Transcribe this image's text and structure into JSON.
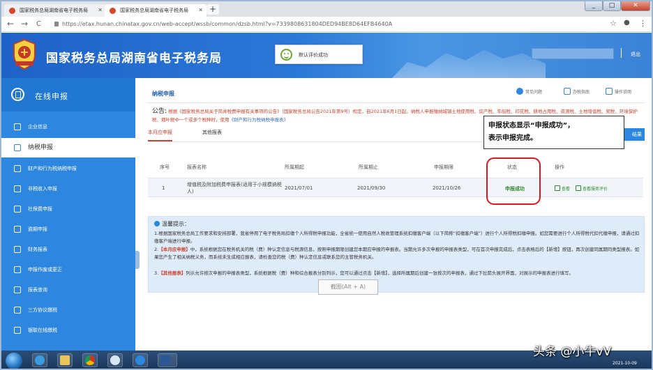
{
  "browser": {
    "tabs": [
      {
        "title": "国家税务总局湖南省电子税务局"
      },
      {
        "title": "国家税务总局湖南省电子税务局"
      }
    ],
    "new_tab": "+",
    "url": "https://etax.hunan.chinatax.gov.cn/web-accept/wssb/common/dzsb.html?v=7339808631804DED94BE8D64EFB4640A",
    "nav": {
      "back": "←",
      "forward": "→",
      "reload": "C"
    },
    "star": "☆",
    "menu": "⋮",
    "win": {
      "min": "_",
      "max": "□",
      "close": "✕"
    }
  },
  "header": {
    "site_title": "国家税务总局湖南省电子税务局",
    "toast_text": "默认评价成功",
    "logout": "退出",
    "emblem_text": "国家税务"
  },
  "sidebar": {
    "title": "在线申报",
    "items": [
      {
        "label": "企业信息"
      },
      {
        "label": "纳税申报"
      },
      {
        "label": "财产和行为税纳税申报"
      },
      {
        "label": "非税收入申报"
      },
      {
        "label": "社保费申报"
      },
      {
        "label": "逾期申报"
      },
      {
        "label": "财务报表"
      },
      {
        "label": "申报作废或更正"
      },
      {
        "label": "报表查询"
      },
      {
        "label": "三方协议缴税"
      },
      {
        "label": "银联在线缴税"
      }
    ]
  },
  "main": {
    "breadcrumb": "纳税申报",
    "tools": [
      "常见问题",
      "办税指南",
      "操作说明"
    ],
    "notice_label": "公告:",
    "notice_text": "根据《国家税务总局关于简并税费申报有关事项的公告》（国家税务总局公告2021年第9号）规定，自2021年6月1日起，纳税人申报缴纳城镇土地使用税、房产税、车船税、印花税、耕地占用税、资源税、土地增值税、契税、环境保护税、烟叶税中一个或多个税种时，使用",
    "notice_link": "《财产和行为税纳税申报表》",
    "tabs": [
      "本月应申报",
      "其他报表"
    ],
    "blue_button": "结果",
    "table": {
      "headers": [
        "序号",
        "报表名称",
        "所属期起",
        "所属期止",
        "申报期限",
        "状态",
        "操作"
      ],
      "rows": [
        {
          "index": "1",
          "name": "增值税及附加税费申报表(适用于小规模纳税人)",
          "start": "2021/07/01",
          "end": "2021/09/30",
          "deadline": "2021/10/26",
          "status": "申报成功",
          "op_view": "查看",
          "op_eval": "查看服务评价"
        }
      ]
    },
    "tips": {
      "title": "温馨提示：",
      "p1": "1.根据国家税务总局工作要求和安排部署，我省停用了电子税务局扣缴个人所得税申报功能，全省统一使用自然人税收管理系统扣缴客户端（以下简称“扣缴客户端”）进行个人所得税扣缴申报。如您需要进行个人所得税代扣代缴申报，请通过扣缴客户端进行申报。",
      "p2_label": "【本月应申报】",
      "p2": "中，系统根据您在税务机关的税（费）种认定信息与税源信息，按照申报期限创建您本期应申报的申报表。当期允许多次申报的申报表类型，可在首次申报完成后，点击表格后的【新增】按钮，再次创建同属期同类型报表。如果您产生了相关纳税义务，而系统未生成相应报表，请检查您的税（费）种认定信息或联系您的主管税务机关。",
      "p2_prefix": "2.",
      "p3_prefix": "3.",
      "p3_label": "【其他报表】",
      "p3": "列示允许按次申报的申报表类型，系统根据税（费）种和综合报表分别列示，您可以通过点击【新增】，选择所属期后创建一张按次的申报表，通过下拉箭头展开界面，对展示的申报表进行填写。"
    },
    "screenshot_hint": "截图(Alt + A)"
  },
  "callout": {
    "line1": "申报状态显示“申报成功”，",
    "line2": "表示申报完成。"
  },
  "taskbar": {
    "watermark": "头条 @小牛vV",
    "date": "2021-10-09"
  }
}
